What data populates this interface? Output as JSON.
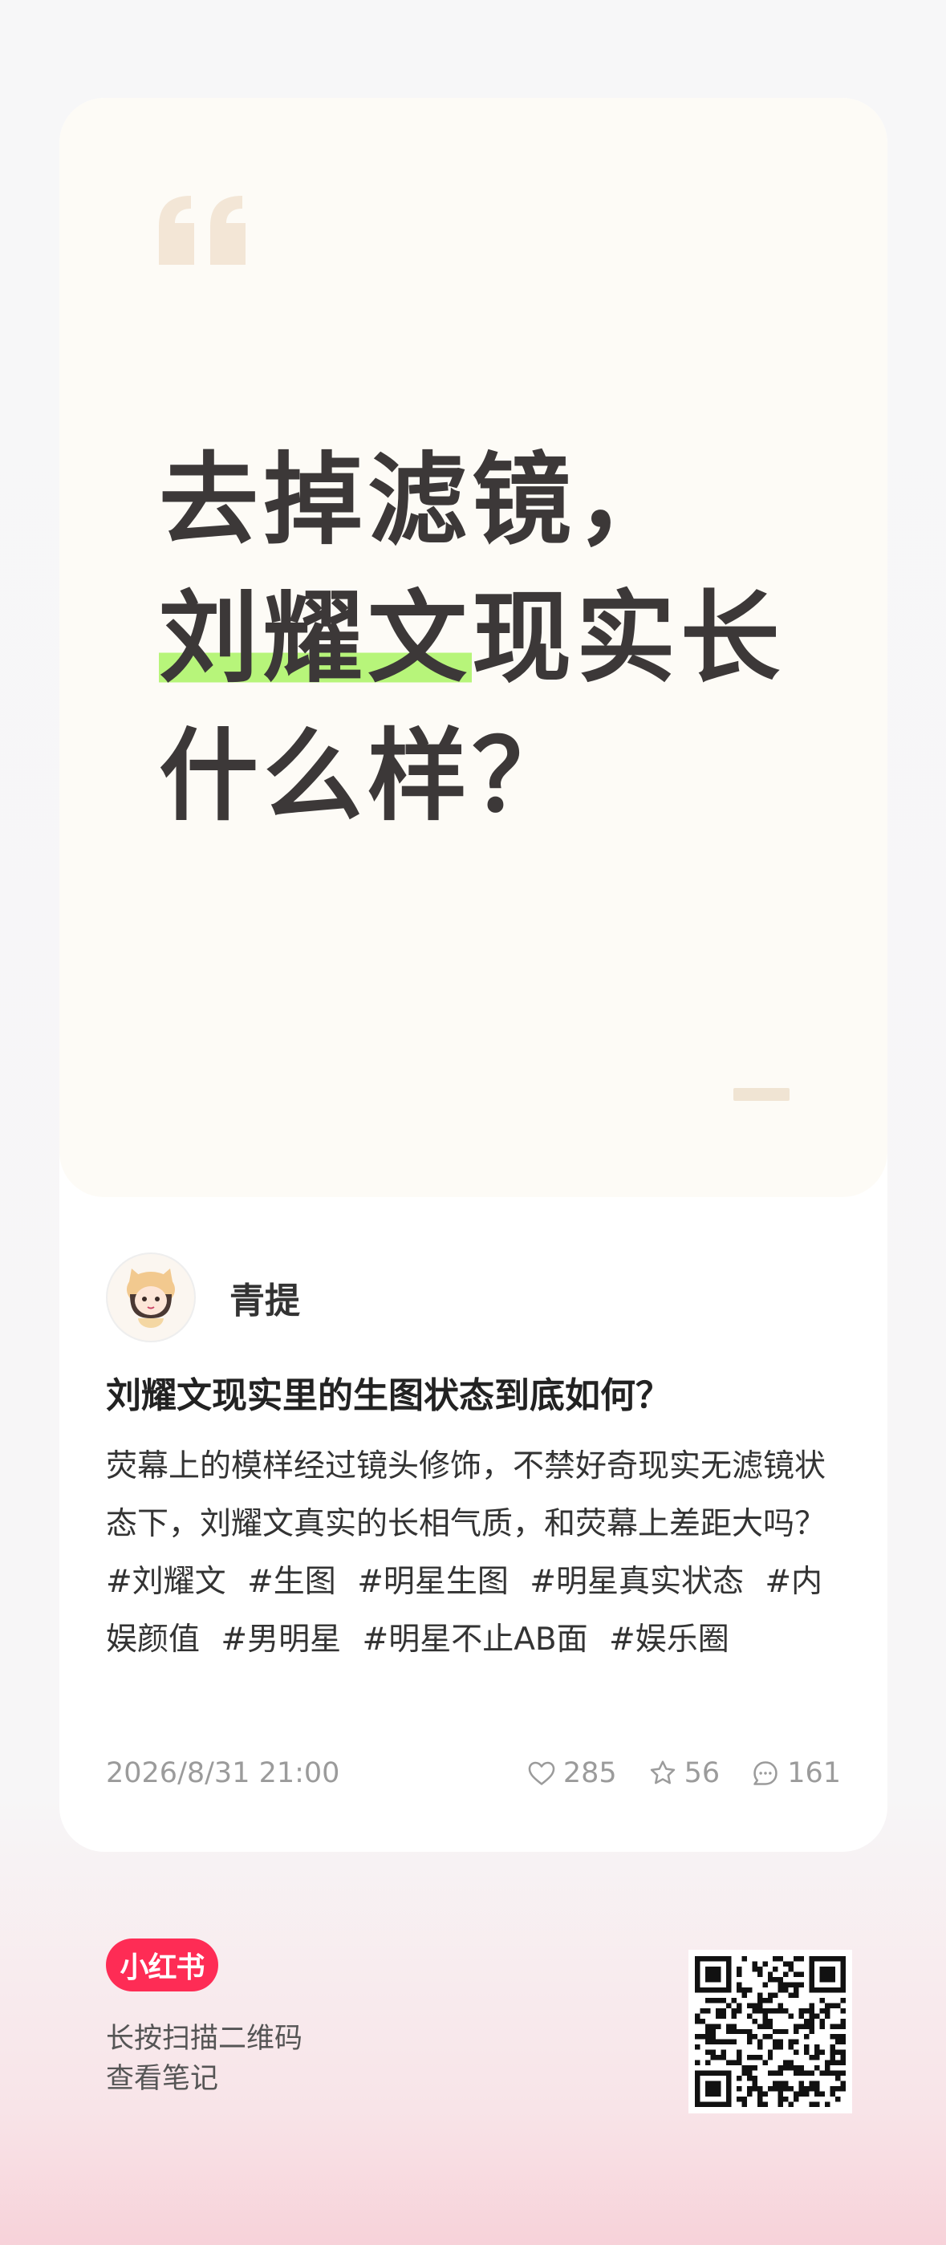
{
  "cover": {
    "headline_line1": "去掉滤镜，",
    "headline_line2_highlight": "刘耀文",
    "headline_line2_rest": "现实长",
    "headline_line3": "什么样？",
    "highlight_color": "#b7f57a",
    "quote_icon": "open-quote-icon"
  },
  "author": {
    "name": "青提",
    "avatar_icon": "cartoon-girl-avatar"
  },
  "note": {
    "title": "刘耀文现实里的生图状态到底如何？",
    "body": "荧幕上的模样经过镜头修饰，不禁好奇现实无滤镜状态下，刘耀文真实的长相气质，和荧幕上差距大吗？",
    "tags": [
      "#刘耀文",
      "#生图",
      " #明星生图",
      "#明星真实状态",
      " #内娱颜值",
      "#男明星",
      " #明星不止AB面",
      " #娱乐圈"
    ]
  },
  "meta": {
    "date": "2026/8/31 21:00",
    "likes": "285",
    "collects": "56",
    "comments": "161"
  },
  "footer": {
    "brand": "小红书",
    "brand_color": "#fe2c55",
    "scan_line1": "长按扫描二维码",
    "scan_line2": "查看笔记"
  }
}
